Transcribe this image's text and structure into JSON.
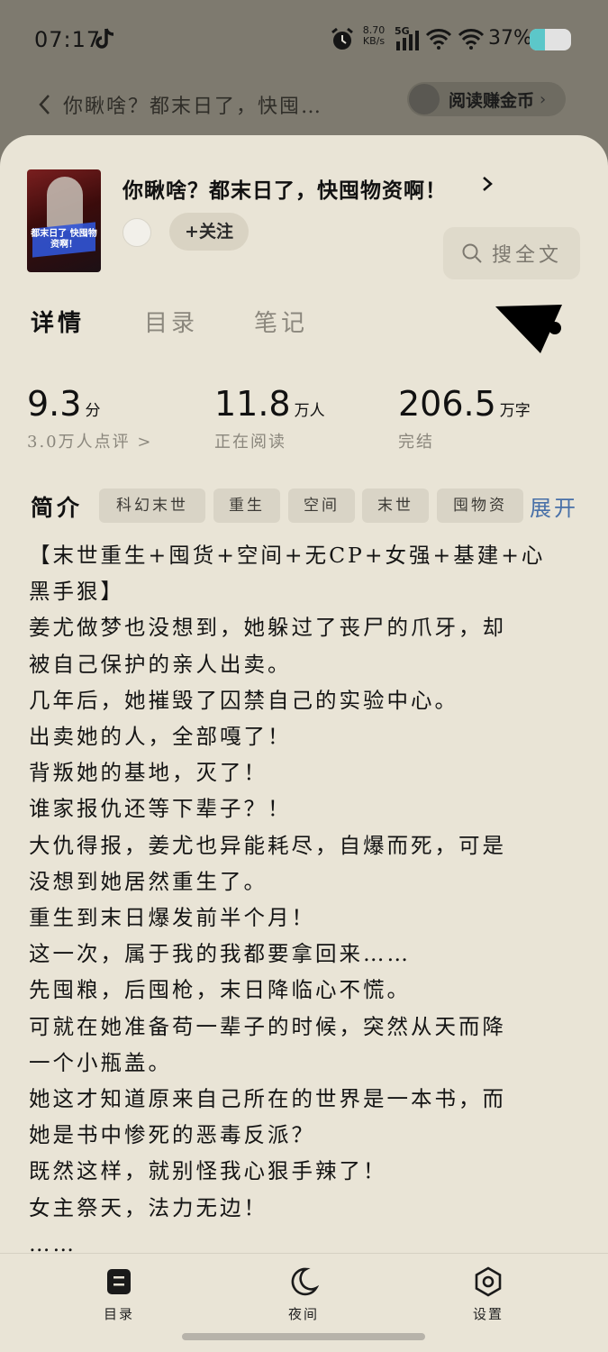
{
  "status_bar": {
    "time": "07:17",
    "net_speed_value": "8.70",
    "net_speed_unit": "KB/s",
    "network": "5G",
    "battery_text": "37%",
    "battery_level": 0.37
  },
  "top_nav": {
    "title": "你瞅啥？都末日了，快囤…",
    "earn_label": "阅读赚金币"
  },
  "book": {
    "title": "你瞅啥？都末日了，快囤物资啊！",
    "cover_text": "都末日了 快囤物资啊！",
    "follow_label": "+关注",
    "search_label": "搜全文"
  },
  "tabs": [
    {
      "label": "详情",
      "active": true
    },
    {
      "label": "目录",
      "active": false
    },
    {
      "label": "笔记",
      "active": false
    }
  ],
  "stats": [
    {
      "value": "9.3",
      "unit": "分",
      "sub": "3.0万人点评 >"
    },
    {
      "value": "11.8",
      "unit": "万人",
      "sub": "正在阅读"
    },
    {
      "value": "206.5",
      "unit": "万字",
      "sub": "完结"
    }
  ],
  "intro": {
    "label": "简介",
    "tags": [
      "科幻末世",
      "重生",
      "空间",
      "末世",
      "囤物资"
    ],
    "expand_label": "展开",
    "lines": [
      "【末世重生+囤货+空间+无CP+女强+基建+心",
      "黑手狠】",
      "姜尤做梦也没想到，她躲过了丧尸的爪牙，却",
      "被自己保护的亲人出卖。",
      "几年后，她摧毁了囚禁自己的实验中心。",
      "出卖她的人，全部嘎了！",
      "背叛她的基地，灭了！",
      "谁家报仇还等下辈子？！",
      "大仇得报，姜尤也异能耗尽，自爆而死，可是",
      "没想到她居然重生了。",
      "重生到末日爆发前半个月！",
      "这一次，属于我的我都要拿回来……",
      "先囤粮，后囤枪，末日降临心不慌。",
      "可就在她准备苟一辈子的时候，突然从天而降",
      "一个小瓶盖。",
      "她这才知道原来自己所在的世界是一本书，而",
      "她是书中惨死的恶毒反派？",
      "既然这样，就别怪我心狠手辣了！",
      "女主祭天，法力无边！",
      "……"
    ]
  },
  "bottom_bar": [
    {
      "label": "目录",
      "icon": "catalog-icon"
    },
    {
      "label": "夜间",
      "icon": "moon-icon"
    },
    {
      "label": "设置",
      "icon": "settings-icon"
    }
  ]
}
